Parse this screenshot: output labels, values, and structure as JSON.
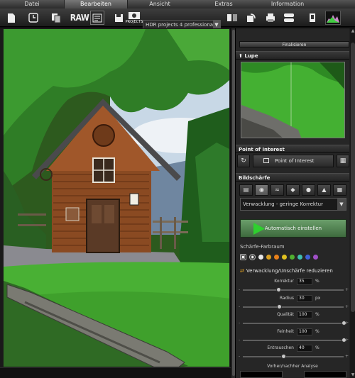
{
  "menubar": {
    "items": [
      {
        "label": "Datei",
        "active": false
      },
      {
        "label": "Bearbeiten",
        "active": true
      },
      {
        "label": "Ansicht",
        "active": false
      },
      {
        "label": "Extras",
        "active": false
      },
      {
        "label": "Information",
        "active": false
      }
    ]
  },
  "toolbar": {
    "raw_label": "RAW",
    "projects_label": "PROJECTS",
    "profile_value": "HDR projects 4 professional",
    "icons": [
      "new-file-icon",
      "history-icon",
      "copy-icon",
      "raw-icon",
      "batch-icon",
      "save-icon",
      "projects-icon",
      "profile-dropdown-icon",
      "compare-icon",
      "rotate-icon",
      "print-icon",
      "presets-icon",
      "crop-icon",
      "histogram-icon"
    ]
  },
  "panel": {
    "finalize_label": "Finalisieren",
    "lupe_title": "Lupe",
    "poi_title": "Point of Interest",
    "poi_button": "Point of Interest",
    "sharpness_title": "Bildschärfe",
    "preset_value": "Verwacklung - geringe Korrektur",
    "auto_button": "Automatisch einstellen",
    "colorspace_label": "Schärfe-Farbraum",
    "colorspace_colors": [
      "#e8e8e8",
      "#d9a020",
      "#e8801a",
      "#e0c020",
      "#50b030",
      "#40c0b0",
      "#4060d8",
      "#a050c8"
    ],
    "shake_label": "Verwacklung/Unschärfe reduzieren",
    "sliders": [
      {
        "label": "Korrektur",
        "value": "35",
        "unit": "%",
        "min": "-",
        "max": "+",
        "level": 0.35
      },
      {
        "label": "Radius",
        "value": "30",
        "unit": "px",
        "min": "-",
        "max": "+",
        "level": 0.36
      },
      {
        "label": "Qualität",
        "value": "100",
        "unit": "%",
        "min": "-",
        "max": "+",
        "level": 1.0
      },
      {
        "label": "Feinheit",
        "value": "100",
        "unit": "%",
        "min": "-",
        "max": "+",
        "level": 1.0
      },
      {
        "label": "Entrauschen",
        "value": "40",
        "unit": "%",
        "min": "-",
        "max": "+",
        "level": 0.4
      }
    ],
    "analysis_label": "Vorher/nachher Analyse"
  }
}
